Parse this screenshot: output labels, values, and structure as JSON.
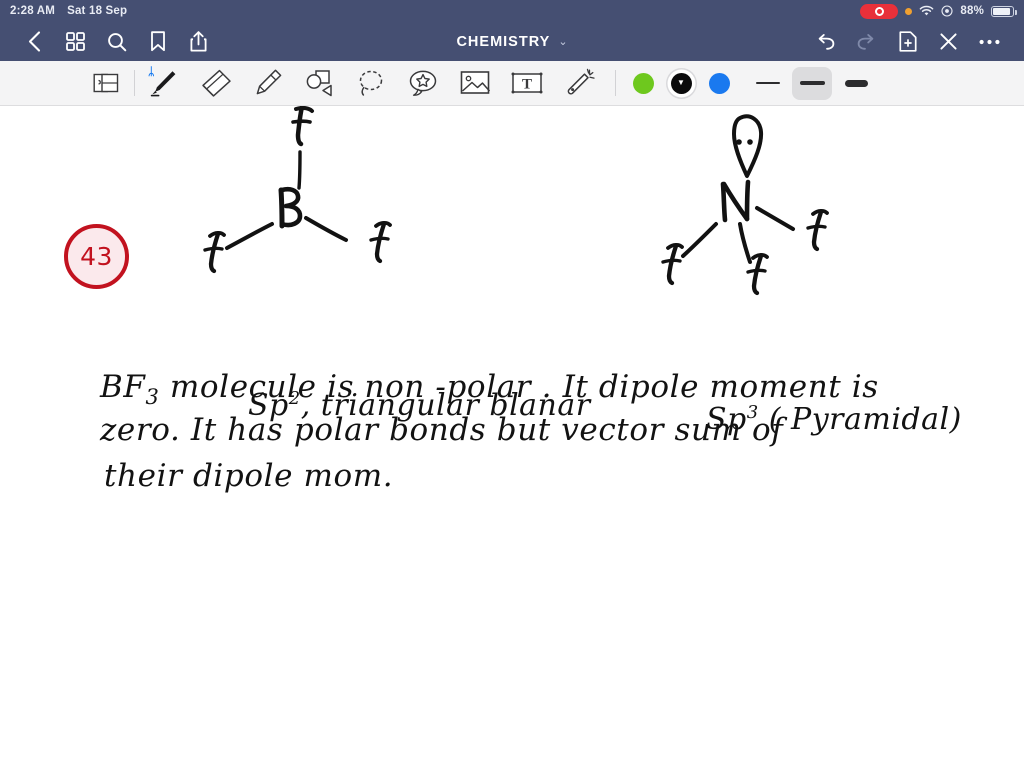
{
  "status_bar": {
    "time": "2:28 AM",
    "date": "Sat 18 Sep",
    "battery_percent": "88%",
    "icons": [
      "screen-record-indicator",
      "orange-dot",
      "wifi-icon",
      "control-center-icon",
      "battery-icon"
    ]
  },
  "nav_bar": {
    "title": "CHEMISTRY",
    "title_chevron": "⌄",
    "left_items": [
      {
        "name": "back-button",
        "icon": "chevron-left-icon"
      },
      {
        "name": "grid-view-button",
        "icon": "grid-icon"
      },
      {
        "name": "search-button",
        "icon": "search-icon"
      },
      {
        "name": "bookmark-button",
        "icon": "bookmark-icon"
      },
      {
        "name": "share-button",
        "icon": "share-icon"
      }
    ],
    "right_items": [
      {
        "name": "undo-button",
        "icon": "undo-icon",
        "enabled": "true"
      },
      {
        "name": "redo-button",
        "icon": "redo-icon",
        "enabled": "false"
      },
      {
        "name": "add-page-button",
        "icon": "add-page-icon"
      },
      {
        "name": "close-button",
        "icon": "close-icon"
      },
      {
        "name": "more-button",
        "icon": "more-icon"
      }
    ]
  },
  "toolbar": {
    "tools": [
      {
        "name": "page-layers-tool",
        "icon": "page-layers-icon",
        "selected": "false"
      },
      {
        "name": "pen-tool",
        "icon": "pen-icon",
        "selected": "true",
        "badge": "bluetooth-icon",
        "badge_glyph": "ᛦ"
      },
      {
        "name": "eraser-tool",
        "icon": "eraser-icon",
        "selected": "false"
      },
      {
        "name": "highlighter-tool",
        "icon": "highlighter-icon",
        "selected": "false"
      },
      {
        "name": "shapes-tool",
        "icon": "shapes-icon",
        "selected": "false"
      },
      {
        "name": "lasso-tool",
        "icon": "lasso-icon",
        "selected": "false"
      },
      {
        "name": "sticker-tool",
        "icon": "star-bubble-icon",
        "selected": "false"
      },
      {
        "name": "image-tool",
        "icon": "image-icon",
        "selected": "false"
      },
      {
        "name": "text-tool",
        "icon": "text-box-icon",
        "selected": "false"
      },
      {
        "name": "magic-wand-tool",
        "icon": "magic-wand-icon",
        "selected": "false"
      }
    ],
    "colors": [
      {
        "name": "color-swatch-green",
        "hex": "#6ec81e",
        "selected": "false"
      },
      {
        "name": "color-swatch-black",
        "hex": "#0b0b0c",
        "selected": "true"
      },
      {
        "name": "color-swatch-blue",
        "hex": "#1a79ef",
        "selected": "false"
      }
    ],
    "stroke_widths": [
      {
        "name": "stroke-width-thin",
        "selected": "false"
      },
      {
        "name": "stroke-width-medium",
        "selected": "true"
      },
      {
        "name": "stroke-width-thick",
        "selected": "false"
      }
    ]
  },
  "canvas": {
    "question_badge": "43",
    "badge_color": "#c2121f",
    "ink_color": "#121212",
    "diagrams": [
      {
        "name": "bf3-lewis-structure",
        "center_atom": "B",
        "substituents": [
          "F",
          "F",
          "F"
        ],
        "caption_main": "Sp",
        "caption_sup": "2",
        "caption_rest": ", triangular blanar"
      },
      {
        "name": "nf3-lewis-structure",
        "center_atom": "N",
        "lone_pair": "lone-pair-dots",
        "substituents": [
          "F",
          "F",
          "F"
        ],
        "caption_main": "Sp",
        "caption_sup": "3",
        "caption_rest": "( Pyramidal)"
      }
    ],
    "answer_lines": [
      "BF3 molecule is  non -polar . It dipole moment is",
      "zero. It has  polar bonds  but  vector sum of",
      "their dipole  mom."
    ],
    "answer_line1_parts": {
      "pre": "BF",
      "sub": "3",
      "post": " molecule  is   non -polar . It dipole moment is"
    }
  }
}
